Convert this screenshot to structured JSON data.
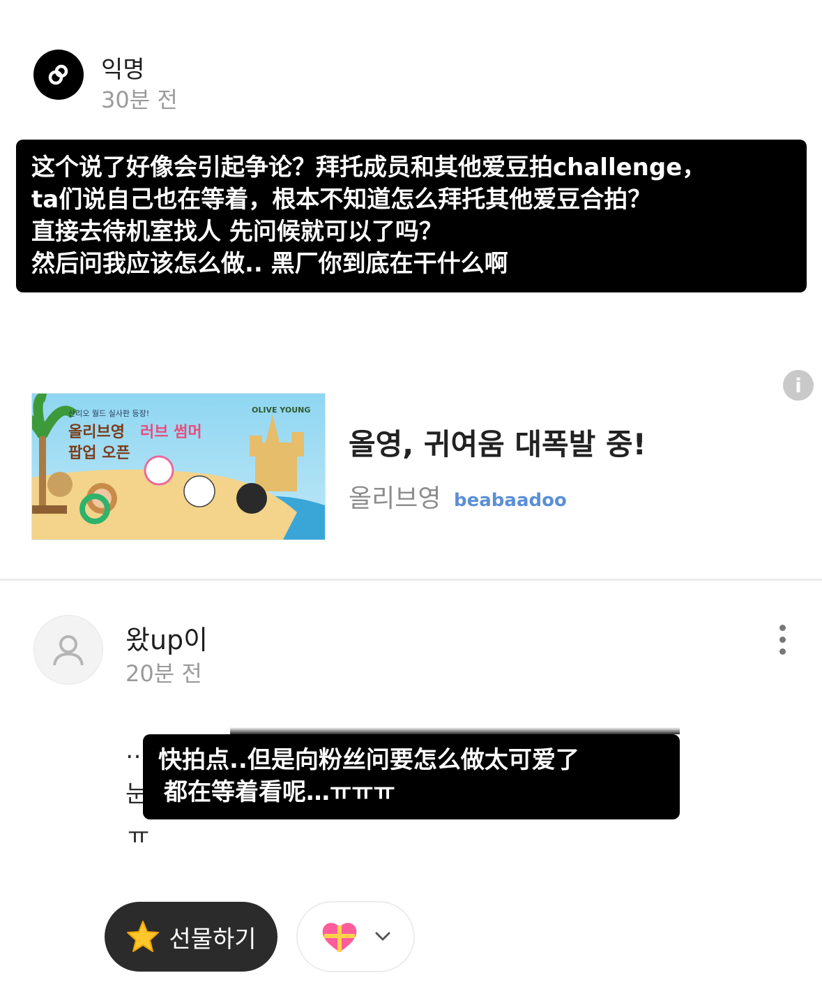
{
  "post": {
    "author": "익명",
    "time": "30분 전",
    "subtitle_lines": [
      "这个说了好像会引起争论？拜托成员和其他爱豆拍challenge，",
      "ta们说自己也在等着，根本不知道怎么拜托其他爱豆合拍？",
      "直接去待机室找人  先问候就可以了吗？",
      "然后问我应该怎么做..  黑厂你到底在干什么啊"
    ]
  },
  "ad": {
    "image_text": {
      "small": "산리오 월드 실사판 등장!",
      "brand_logo": "OLIVE YOUNG",
      "headline_1a": "올리브영",
      "headline_1b": "러브 썸머",
      "headline_2": "팝업 오픈"
    },
    "title": "올영, 귀여움 대폭발 중!",
    "brand": "올리브영",
    "watermark": "beabaadoo"
  },
  "comment": {
    "author": "왔up이",
    "time": "20분 전",
    "text_lines": [
      "…",
      "눈",
      "ㅠ"
    ],
    "subtitle_lines": [
      "快拍点..但是向粉丝问要怎么做太可爱了",
      "都在等着看呢…ㅠㅠㅠ"
    ],
    "gift_label": "선물하기"
  },
  "colors": {
    "gift_bg": "#2b2b2b",
    "divider": "#ececec",
    "time_gray": "#9a9a9a"
  },
  "icons": [
    "anon-logo-icon",
    "info-icon",
    "user-avatar-icon",
    "kebab-menu-icon",
    "star-icon",
    "heart-gift-icon",
    "chevron-down-icon"
  ]
}
